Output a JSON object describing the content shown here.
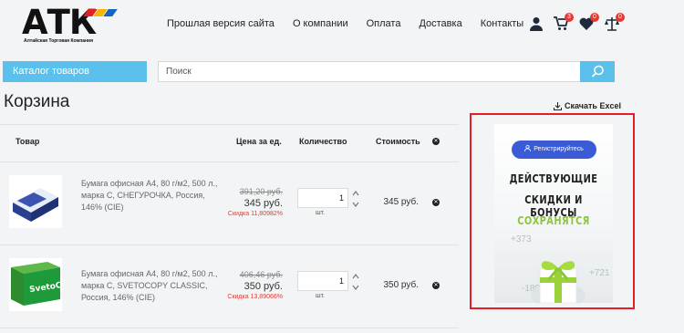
{
  "logo": {
    "text": "АТК",
    "subtitle": "Алтайская Торговая Компания"
  },
  "nav": [
    "Прошлая версия сайта",
    "О компании",
    "Оплата",
    "Доставка",
    "Контакты"
  ],
  "header_icons": [
    {
      "name": "user-icon"
    },
    {
      "name": "cart-icon",
      "badge": "3"
    },
    {
      "name": "heart-icon",
      "badge": "0"
    },
    {
      "name": "compare-icon",
      "badge": "0"
    }
  ],
  "catalog_button": "Каталог товаров",
  "search": {
    "placeholder": "Поиск"
  },
  "cart": {
    "title": "Корзина",
    "download_excel": "Скачать Excel",
    "headers": {
      "product": "Товар",
      "price": "Цена за ед.",
      "quantity": "Количество",
      "cost": "Стоимость"
    },
    "items": [
      {
        "description": "Бумага офисная А4, 80 г/м2, 500 л., марка С, СНЕГУРОЧКА, Россия, 146% (CIE)",
        "old_price": "391,20 руб.",
        "price": "345 руб.",
        "discount": "Скидка 11,80982%",
        "quantity": "1",
        "unit": "шт.",
        "cost": "345 руб."
      },
      {
        "description": "Бумага офисная А4, 80 г/м2, 500 л., марка С, SVETOCOPY CLASSIC, Россия, 146% (CIE)",
        "old_price": "406,46 руб.",
        "price": "350 руб.",
        "discount": "Скидка 13,89066%",
        "quantity": "1",
        "unit": "шт.",
        "cost": "350 руб."
      }
    ]
  },
  "banner": {
    "button": "Регистрируйтесь",
    "line1": "ДЕЙСТВУЮЩИЕ",
    "line2": "СКИДКИ И БОНУСЫ",
    "line3": "СОХРАНЯТСЯ",
    "numbers": [
      "+373",
      "+721",
      "-1897"
    ]
  },
  "colors": {
    "accent": "#5bc0eb",
    "badge": "#e53935",
    "frame": "#e31e24",
    "banner_button": "#3b5bd6",
    "green": "#8cc63f"
  }
}
